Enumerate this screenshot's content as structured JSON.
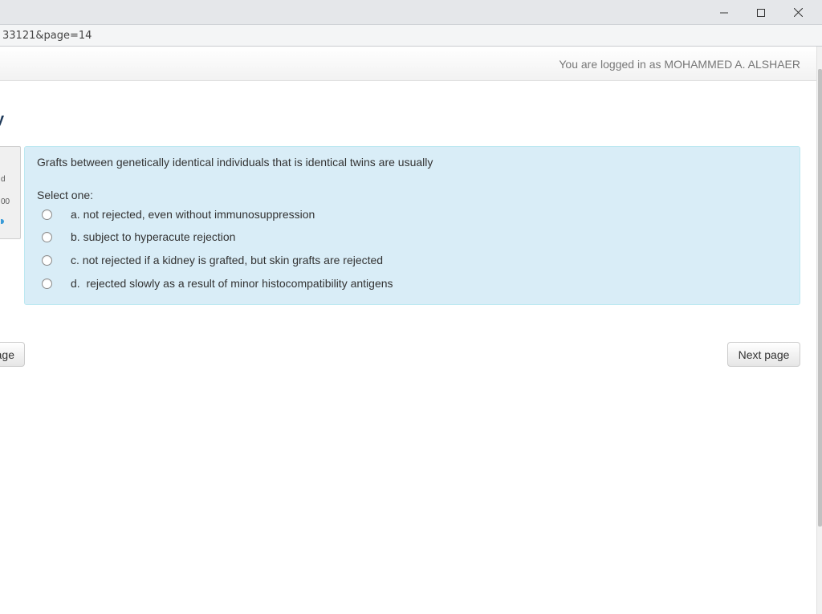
{
  "browser": {
    "url_fragment": "33121&page=14",
    "window_controls": {
      "minimize": "minimize-icon",
      "maximize": "maximize-icon",
      "close": "close-icon"
    }
  },
  "navbar": {
    "login_info": "You are logged in as MOHAMMED A. ALSHAER"
  },
  "page": {
    "title_fragment": "y"
  },
  "question_info": {
    "state_fragment": "d",
    "mark_fragment": "00"
  },
  "question": {
    "text": "Grafts between genetically identical individuals that is identical twins are usually",
    "prompt": "Select one:",
    "answers": [
      {
        "label": "a. not rejected, even without immunosuppression",
        "selected": false
      },
      {
        "label": "b. subject to hyperacute rejection",
        "selected": false
      },
      {
        "label": "c. not rejected if a kidney is grafted, but skin grafts are rejected",
        "selected": false
      },
      {
        "label": "d.  rejected slowly as a result of minor histocompatibility antigens",
        "selected": false
      }
    ]
  },
  "navigation": {
    "previous_fragment": "age",
    "next_label": "Next page"
  },
  "colors": {
    "question_bg": "#d9edf7",
    "question_border": "#bce8f1",
    "title_color": "#1f3a5a",
    "login_text": "#777777"
  }
}
